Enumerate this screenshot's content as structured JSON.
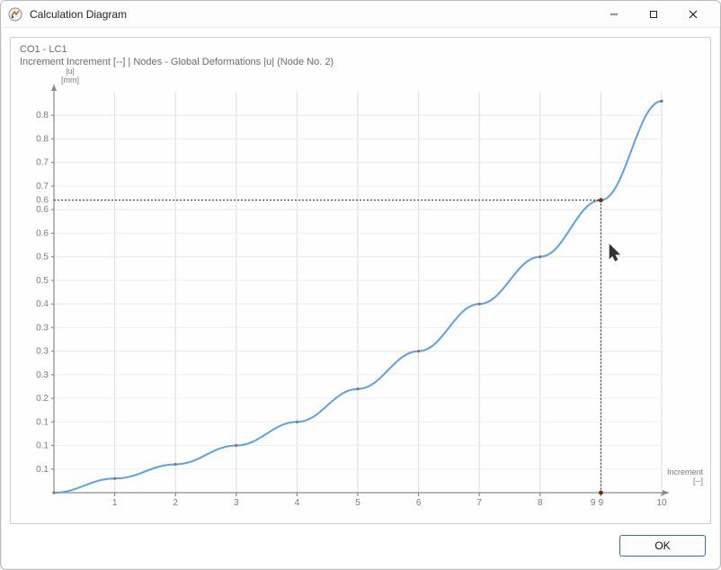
{
  "window": {
    "title": "Calculation Diagram"
  },
  "meta": {
    "line1": "CO1 - LC1",
    "line2": "Increment Increment [--] | Nodes - Global Deformations |u| (Node No. 2)"
  },
  "axis": {
    "y_label_line1": "|u|",
    "y_label_line2": "[mm]",
    "x_label_line1": "Increment",
    "x_label_line2": "[--]"
  },
  "buttons": {
    "ok": "OK"
  },
  "chart_data": {
    "type": "line",
    "title": "",
    "xlabel": "Increment [--]",
    "ylabel": "|u| [mm]",
    "xlim": [
      0,
      10
    ],
    "ylim": [
      0,
      0.85
    ],
    "grid": true,
    "x_ticks": [
      1,
      2,
      3,
      4,
      5,
      6,
      7,
      8,
      9,
      10
    ],
    "y_ticks_major": [
      0.1,
      0.2,
      0.3,
      0.4,
      0.5,
      0.6,
      0.7,
      0.8
    ],
    "y_ticks_minor": [
      0.05,
      0.1,
      0.15,
      0.2,
      0.25,
      0.3,
      0.35,
      0.4,
      0.45,
      0.5,
      0.55,
      0.6,
      0.65,
      0.7,
      0.75,
      0.8
    ],
    "series": [
      {
        "name": "|u|",
        "x": [
          0,
          1,
          2,
          3,
          4,
          5,
          6,
          7,
          8,
          9,
          10
        ],
        "y": [
          0.0,
          0.03,
          0.06,
          0.1,
          0.15,
          0.22,
          0.3,
          0.4,
          0.5,
          0.62,
          0.83
        ]
      }
    ],
    "highlight": {
      "x": 9,
      "y": 0.62
    },
    "highlight_label": "9"
  }
}
